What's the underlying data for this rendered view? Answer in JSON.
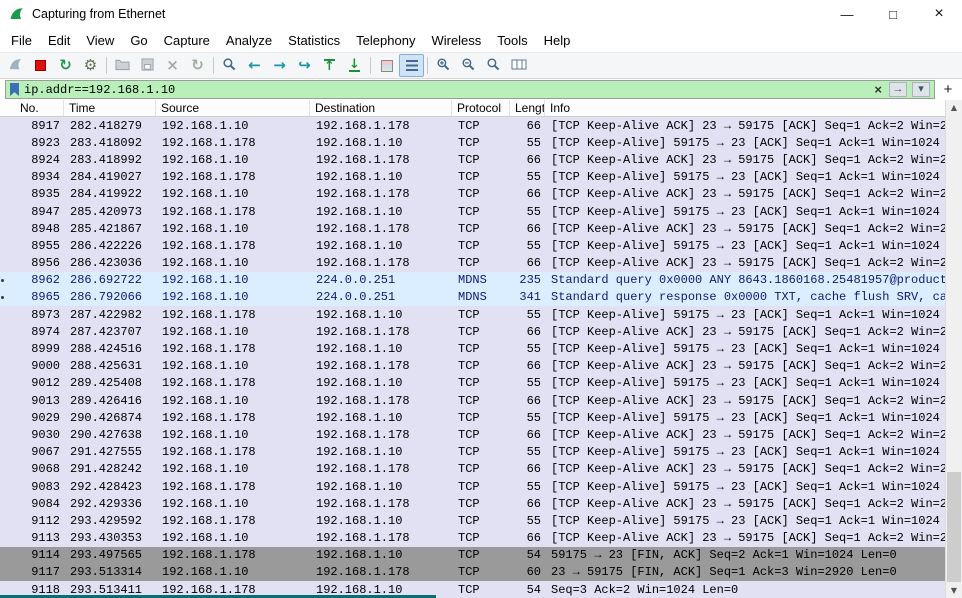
{
  "window": {
    "title": "Capturing from Ethernet",
    "controls": {
      "minimize": "—",
      "maximize": "□",
      "close": "×"
    }
  },
  "menu": {
    "items": [
      "File",
      "Edit",
      "View",
      "Go",
      "Capture",
      "Analyze",
      "Statistics",
      "Telephony",
      "Wireless",
      "Tools",
      "Help"
    ]
  },
  "toolbar": {
    "icons": [
      "start-capture",
      "stop-capture",
      "restart-capture",
      "capture-options",
      "open-file",
      "save-file",
      "close-capture",
      "reload",
      "find-packet",
      "go-back",
      "go-forward",
      "go-to-packet",
      "go-first",
      "go-last",
      "colorize-packets",
      "auto-scroll",
      "zoom-in",
      "zoom-out",
      "zoom-original",
      "resize-columns"
    ]
  },
  "filter": {
    "value": "ip.addr==192.168.1.10",
    "clear_label": "×",
    "apply_label": "→",
    "dropdown_label": "▾",
    "add_label": "+"
  },
  "scrollbar": {
    "up": "▲",
    "down": "▼"
  },
  "colors": {
    "row_tcp": "#e2e1f4",
    "row_mdns": "#daeeff",
    "row_syn_fin": "#9a9a9a",
    "filter_valid_green": "#b9f0b9",
    "wireshark_green": "#1e9c4c"
  },
  "packet_list": {
    "columns": [
      "No.",
      "Time",
      "Source",
      "Destination",
      "Protocol",
      "Length",
      "Info"
    ],
    "rows": [
      {
        "no": "8917",
        "time": "282.418279",
        "source": "192.168.1.10",
        "destination": "192.168.1.178",
        "protocol": "TCP",
        "length": "66",
        "info": "[TCP Keep-Alive ACK] 23 → 59175 [ACK] Seq=1 Ack=2 Win=2",
        "color": "tcp"
      },
      {
        "no": "8923",
        "time": "283.418092",
        "source": "192.168.1.178",
        "destination": "192.168.1.10",
        "protocol": "TCP",
        "length": "55",
        "info": "[TCP Keep-Alive] 59175 → 23 [ACK] Seq=1 Ack=1 Win=1024",
        "color": "tcp"
      },
      {
        "no": "8924",
        "time": "283.418992",
        "source": "192.168.1.10",
        "destination": "192.168.1.178",
        "protocol": "TCP",
        "length": "66",
        "info": "[TCP Keep-Alive ACK] 23 → 59175 [ACK] Seq=1 Ack=2 Win=2",
        "color": "tcp"
      },
      {
        "no": "8934",
        "time": "284.419027",
        "source": "192.168.1.178",
        "destination": "192.168.1.10",
        "protocol": "TCP",
        "length": "55",
        "info": "[TCP Keep-Alive] 59175 → 23 [ACK] Seq=1 Ack=1 Win=1024",
        "color": "tcp"
      },
      {
        "no": "8935",
        "time": "284.419922",
        "source": "192.168.1.10",
        "destination": "192.168.1.178",
        "protocol": "TCP",
        "length": "66",
        "info": "[TCP Keep-Alive ACK] 23 → 59175 [ACK] Seq=1 Ack=2 Win=2",
        "color": "tcp"
      },
      {
        "no": "8947",
        "time": "285.420973",
        "source": "192.168.1.178",
        "destination": "192.168.1.10",
        "protocol": "TCP",
        "length": "55",
        "info": "[TCP Keep-Alive] 59175 → 23 [ACK] Seq=1 Ack=1 Win=1024",
        "color": "tcp"
      },
      {
        "no": "8948",
        "time": "285.421867",
        "source": "192.168.1.10",
        "destination": "192.168.1.178",
        "protocol": "TCP",
        "length": "66",
        "info": "[TCP Keep-Alive ACK] 23 → 59175 [ACK] Seq=1 Ack=2 Win=2",
        "color": "tcp"
      },
      {
        "no": "8955",
        "time": "286.422226",
        "source": "192.168.1.178",
        "destination": "192.168.1.10",
        "protocol": "TCP",
        "length": "55",
        "info": "[TCP Keep-Alive] 59175 → 23 [ACK] Seq=1 Ack=1 Win=1024",
        "color": "tcp"
      },
      {
        "no": "8956",
        "time": "286.423036",
        "source": "192.168.1.10",
        "destination": "192.168.1.178",
        "protocol": "TCP",
        "length": "66",
        "info": "[TCP Keep-Alive ACK] 23 → 59175 [ACK] Seq=1 Ack=2 Win=2",
        "color": "tcp"
      },
      {
        "no": "8962",
        "time": "286.692722",
        "source": "192.168.1.10",
        "destination": "224.0.0.251",
        "protocol": "MDNS",
        "length": "235",
        "info": "Standard query 0x0000 ANY 8643.1860168.25481957@product",
        "color": "mdns"
      },
      {
        "no": "8965",
        "time": "286.792066",
        "source": "192.168.1.10",
        "destination": "224.0.0.251",
        "protocol": "MDNS",
        "length": "341",
        "info": "Standard query response 0x0000 TXT, cache flush SRV, ca",
        "color": "mdns"
      },
      {
        "no": "8973",
        "time": "287.422982",
        "source": "192.168.1.178",
        "destination": "192.168.1.10",
        "protocol": "TCP",
        "length": "55",
        "info": "[TCP Keep-Alive] 59175 → 23 [ACK] Seq=1 Ack=1 Win=1024",
        "color": "tcp"
      },
      {
        "no": "8974",
        "time": "287.423707",
        "source": "192.168.1.10",
        "destination": "192.168.1.178",
        "protocol": "TCP",
        "length": "66",
        "info": "[TCP Keep-Alive ACK] 23 → 59175 [ACK] Seq=1 Ack=2 Win=2",
        "color": "tcp"
      },
      {
        "no": "8999",
        "time": "288.424516",
        "source": "192.168.1.178",
        "destination": "192.168.1.10",
        "protocol": "TCP",
        "length": "55",
        "info": "[TCP Keep-Alive] 59175 → 23 [ACK] Seq=1 Ack=1 Win=1024",
        "color": "tcp"
      },
      {
        "no": "9000",
        "time": "288.425631",
        "source": "192.168.1.10",
        "destination": "192.168.1.178",
        "protocol": "TCP",
        "length": "66",
        "info": "[TCP Keep-Alive ACK] 23 → 59175 [ACK] Seq=1 Ack=2 Win=2",
        "color": "tcp"
      },
      {
        "no": "9012",
        "time": "289.425408",
        "source": "192.168.1.178",
        "destination": "192.168.1.10",
        "protocol": "TCP",
        "length": "55",
        "info": "[TCP Keep-Alive] 59175 → 23 [ACK] Seq=1 Ack=1 Win=1024",
        "color": "tcp"
      },
      {
        "no": "9013",
        "time": "289.426416",
        "source": "192.168.1.10",
        "destination": "192.168.1.178",
        "protocol": "TCP",
        "length": "66",
        "info": "[TCP Keep-Alive ACK] 23 → 59175 [ACK] Seq=1 Ack=2 Win=2",
        "color": "tcp"
      },
      {
        "no": "9029",
        "time": "290.426874",
        "source": "192.168.1.178",
        "destination": "192.168.1.10",
        "protocol": "TCP",
        "length": "55",
        "info": "[TCP Keep-Alive] 59175 → 23 [ACK] Seq=1 Ack=1 Win=1024",
        "color": "tcp"
      },
      {
        "no": "9030",
        "time": "290.427638",
        "source": "192.168.1.10",
        "destination": "192.168.1.178",
        "protocol": "TCP",
        "length": "66",
        "info": "[TCP Keep-Alive ACK] 23 → 59175 [ACK] Seq=1 Ack=2 Win=2",
        "color": "tcp"
      },
      {
        "no": "9067",
        "time": "291.427555",
        "source": "192.168.1.178",
        "destination": "192.168.1.10",
        "protocol": "TCP",
        "length": "55",
        "info": "[TCP Keep-Alive] 59175 → 23 [ACK] Seq=1 Ack=1 Win=1024",
        "color": "tcp"
      },
      {
        "no": "9068",
        "time": "291.428242",
        "source": "192.168.1.10",
        "destination": "192.168.1.178",
        "protocol": "TCP",
        "length": "66",
        "info": "[TCP Keep-Alive ACK] 23 → 59175 [ACK] Seq=1 Ack=2 Win=2",
        "color": "tcp"
      },
      {
        "no": "9083",
        "time": "292.428423",
        "source": "192.168.1.178",
        "destination": "192.168.1.10",
        "protocol": "TCP",
        "length": "55",
        "info": "[TCP Keep-Alive] 59175 → 23 [ACK] Seq=1 Ack=1 Win=1024",
        "color": "tcp"
      },
      {
        "no": "9084",
        "time": "292.429336",
        "source": "192.168.1.10",
        "destination": "192.168.1.178",
        "protocol": "TCP",
        "length": "66",
        "info": "[TCP Keep-Alive ACK] 23 → 59175 [ACK] Seq=1 Ack=2 Win=2",
        "color": "tcp"
      },
      {
        "no": "9112",
        "time": "293.429592",
        "source": "192.168.1.178",
        "destination": "192.168.1.10",
        "protocol": "TCP",
        "length": "55",
        "info": "[TCP Keep-Alive] 59175 → 23 [ACK] Seq=1 Ack=1 Win=1024",
        "color": "tcp"
      },
      {
        "no": "9113",
        "time": "293.430353",
        "source": "192.168.1.10",
        "destination": "192.168.1.178",
        "protocol": "TCP",
        "length": "66",
        "info": "[TCP Keep-Alive ACK] 23 → 59175 [ACK] Seq=1 Ack=2 Win=2",
        "color": "tcp"
      },
      {
        "no": "9114",
        "time": "293.497565",
        "source": "192.168.1.178",
        "destination": "192.168.1.10",
        "protocol": "TCP",
        "length": "54",
        "info": "59175 → 23 [FIN, ACK] Seq=2 Ack=1 Win=1024 Len=0",
        "color": "fin"
      },
      {
        "no": "9117",
        "time": "293.513314",
        "source": "192.168.1.10",
        "destination": "192.168.1.178",
        "protocol": "TCP",
        "length": "60",
        "info": "23 → 59175 [FIN, ACK] Seq=1 Ack=3 Win=2920 Len=0",
        "color": "fin"
      },
      {
        "no": "9118",
        "time": "293.513411",
        "source": "192.168.1.178",
        "destination": "192.168.1.10",
        "protocol": "TCP",
        "length": "54",
        "info": "Seq=3 Ack=2 Win=1024 Len=0",
        "color": "tcp"
      }
    ]
  }
}
